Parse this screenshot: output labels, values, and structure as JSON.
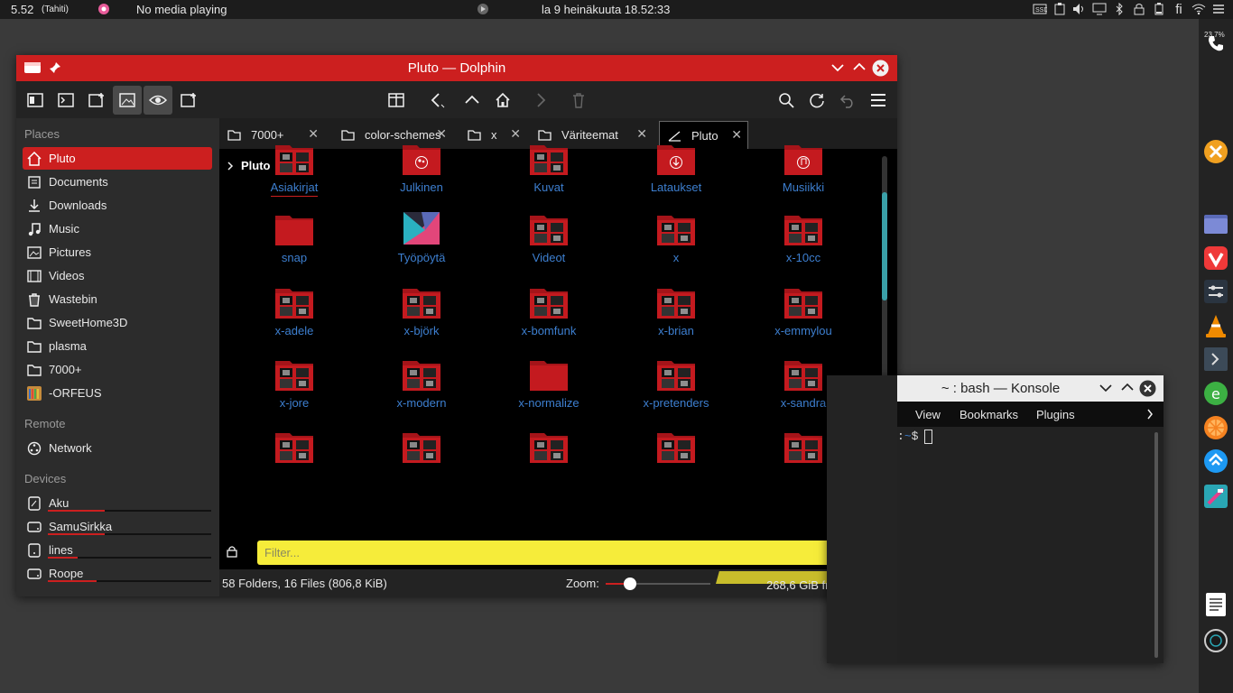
{
  "topbar": {
    "weather": "5.52",
    "weather_location": "(Tahiti)",
    "media": "No media playing",
    "clock": "la 9 heinäkuuta 18.52:33",
    "lang": "fi",
    "tray_icons": [
      "ssd-icon",
      "clipboard-icon",
      "volume-icon",
      "display-icon",
      "bluetooth-icon",
      "lock-icon",
      "battery-icon",
      "language-icon",
      "wifi-icon",
      "menu-icon"
    ]
  },
  "dock": {
    "battery_pct": "23,7%",
    "items": [
      "phone-icon",
      "xmarks-icon",
      "files-icon",
      "vivaldi-icon",
      "settings-icon",
      "vlc-icon",
      "terminal-icon",
      "bookmarks-icon",
      "orange-icon",
      "kde-connect-icon",
      "app-icon",
      "notes-icon",
      "clock-icon"
    ]
  },
  "dolphin": {
    "title": "Pluto — Dolphin",
    "tabs": [
      {
        "label": "7000+"
      },
      {
        "label": "color-schemes"
      },
      {
        "label": "x"
      },
      {
        "label": "Väriteemat"
      },
      {
        "label": "Pluto"
      }
    ],
    "breadcrumb": "Pluto",
    "places_header": "Places",
    "places": [
      "Pluto",
      "Documents",
      "Downloads",
      "Music",
      "Pictures",
      "Videos",
      "Wastebin",
      "SweetHome3D",
      "plasma",
      "7000+",
      "-ORFEUS"
    ],
    "remote_header": "Remote",
    "remote": [
      "Network"
    ],
    "devices_header": "Devices",
    "devices": [
      {
        "label": "Aku",
        "usage": 0.35
      },
      {
        "label": "SamuSirkka",
        "usage": 0.35
      },
      {
        "label": "lines",
        "usage": 0.18
      },
      {
        "label": "Roope",
        "usage": 0.3
      }
    ],
    "items": [
      "Asiakirjat",
      "Julkinen",
      "Kuvat",
      "Lataukset",
      "Musiikki",
      "snap",
      "Työpöytä",
      "Videot",
      "x",
      "x-10cc",
      "x-adele",
      "x-björk",
      "x-bomfunk",
      "x-brian",
      "x-emmylou",
      "x-jore",
      "x-modern",
      "x-normalize",
      "x-pretenders",
      "x-sandra",
      "",
      "",
      "",
      "",
      ""
    ],
    "filter_placeholder": "Filter...",
    "status": "58 Folders, 16 Files (806,8 KiB)",
    "zoom_label": "Zoom:",
    "zoom_level": 0.2,
    "free": "268,6 GiB free",
    "disk_usage": 0.98
  },
  "konsole": {
    "title": "~ : bash — Konsole",
    "menu": [
      "View",
      "Bookmarks",
      "Plugins"
    ],
    "prompt_path": "~",
    "prompt_sign": "$"
  },
  "colors": {
    "accent": "#cc1f1f",
    "link": "#3d7fd0",
    "filter": "#f6ec3a"
  }
}
